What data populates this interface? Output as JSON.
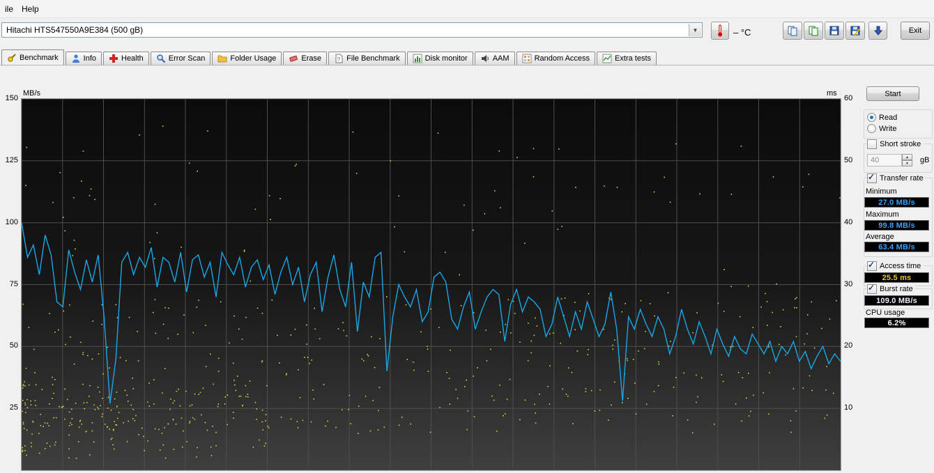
{
  "menu": {
    "file": "ile",
    "help": "Help"
  },
  "toolbar": {
    "drive": "Hitachi HTS547550A9E384  (500 gB)",
    "temperature": "– °C",
    "exit_label": "Exit"
  },
  "tabs": [
    {
      "id": "benchmark",
      "label": "Benchmark",
      "icon": "benchmark-icon",
      "active": true
    },
    {
      "id": "info",
      "label": "Info",
      "icon": "info-icon",
      "active": false
    },
    {
      "id": "health",
      "label": "Health",
      "icon": "health-icon",
      "active": false
    },
    {
      "id": "error-scan",
      "label": "Error Scan",
      "icon": "error-scan-icon",
      "active": false
    },
    {
      "id": "folder-usage",
      "label": "Folder Usage",
      "icon": "folder-icon",
      "active": false
    },
    {
      "id": "erase",
      "label": "Erase",
      "icon": "erase-icon",
      "active": false
    },
    {
      "id": "file-benchmark",
      "label": "File Benchmark",
      "icon": "file-benchmark-icon",
      "active": false
    },
    {
      "id": "disk-monitor",
      "label": "Disk monitor",
      "icon": "disk-monitor-icon",
      "active": false
    },
    {
      "id": "aam",
      "label": "AAM",
      "icon": "aam-icon",
      "active": false
    },
    {
      "id": "random-access",
      "label": "Random Access",
      "icon": "random-access-icon",
      "active": false
    },
    {
      "id": "extra-tests",
      "label": "Extra tests",
      "icon": "extra-tests-icon",
      "active": false
    }
  ],
  "panel": {
    "start_label": "Start",
    "read_label": "Read",
    "write_label": "Write",
    "read_selected": true,
    "short_stroke_label": "Short stroke",
    "short_stroke_checked": false,
    "short_stroke_value": "40",
    "short_stroke_unit": "gB",
    "transfer_rate_label": "Transfer rate",
    "transfer_rate_checked": true,
    "minimum_label": "Minimum",
    "minimum_value": "27.0 MB/s",
    "maximum_label": "Maximum",
    "maximum_value": "99.8 MB/s",
    "average_label": "Average",
    "average_value": "63.4 MB/s",
    "access_time_label": "Access time",
    "access_time_checked": true,
    "access_time_value": "25.5 ms",
    "burst_rate_label": "Burst rate",
    "burst_rate_checked": true,
    "burst_rate_value": "109.0 MB/s",
    "cpu_usage_label": "CPU usage",
    "cpu_usage_value": "6.2%"
  },
  "colors": {
    "transfer_value": "#36a2ff",
    "access_value": "#e6c51c",
    "burst_value": "#eef2ff",
    "cpu_value": "#ffffff"
  },
  "chart_data": {
    "type": "line",
    "title": "HD Tune benchmark: transfer rate and access time vs. disk position",
    "ylabel_left": "MB/s",
    "ylabel_right": "ms",
    "y_left_ticks": [
      150,
      125,
      100,
      75,
      50,
      25
    ],
    "y_right_ticks": [
      60,
      50,
      40,
      30,
      20,
      10
    ],
    "ylim_left": [
      0,
      150
    ],
    "ylim_right": [
      0,
      60
    ],
    "grid": true,
    "line_color": "#18a8e8",
    "scatter_color": "#d8d33e",
    "series": [
      {
        "name": "Transfer rate (MB/s)",
        "values": [
          100,
          86,
          91,
          79,
          95,
          87,
          68,
          66,
          89,
          80,
          73,
          85,
          76,
          87,
          62,
          27,
          45,
          84,
          88,
          79,
          86,
          82,
          90,
          74,
          86,
          84,
          76,
          88,
          72,
          85,
          87,
          78,
          84,
          70,
          88,
          83,
          79,
          86,
          74,
          82,
          85,
          77,
          83,
          71,
          80,
          86,
          75,
          82,
          68,
          79,
          84,
          64,
          78,
          87,
          73,
          66,
          84,
          56,
          76,
          70,
          86,
          88,
          40,
          62,
          75,
          70,
          66,
          73,
          60,
          64,
          78,
          80,
          76,
          61,
          57,
          66,
          72,
          57,
          64,
          70,
          73,
          71,
          52,
          67,
          73,
          64,
          70,
          68,
          65,
          54,
          59,
          70,
          62,
          54,
          64,
          57,
          68,
          61,
          54,
          59,
          72,
          57,
          28,
          62,
          57,
          65,
          59,
          54,
          62,
          57,
          47,
          54,
          65,
          57,
          51,
          60,
          54,
          47,
          57,
          51,
          46,
          54,
          49,
          47,
          55,
          51,
          47,
          52,
          44,
          50,
          47,
          52,
          44,
          48,
          41,
          46,
          50,
          43,
          47,
          44
        ]
      }
    ],
    "scatter": {
      "name": "Access time (ms)",
      "seed": 7,
      "count": 620
    },
    "summary": {
      "minimum_mbs": 27.0,
      "maximum_mbs": 99.8,
      "average_mbs": 63.4,
      "access_time_ms": 25.5,
      "burst_rate_mbs": 109.0,
      "cpu_usage_pct": 6.2
    }
  }
}
